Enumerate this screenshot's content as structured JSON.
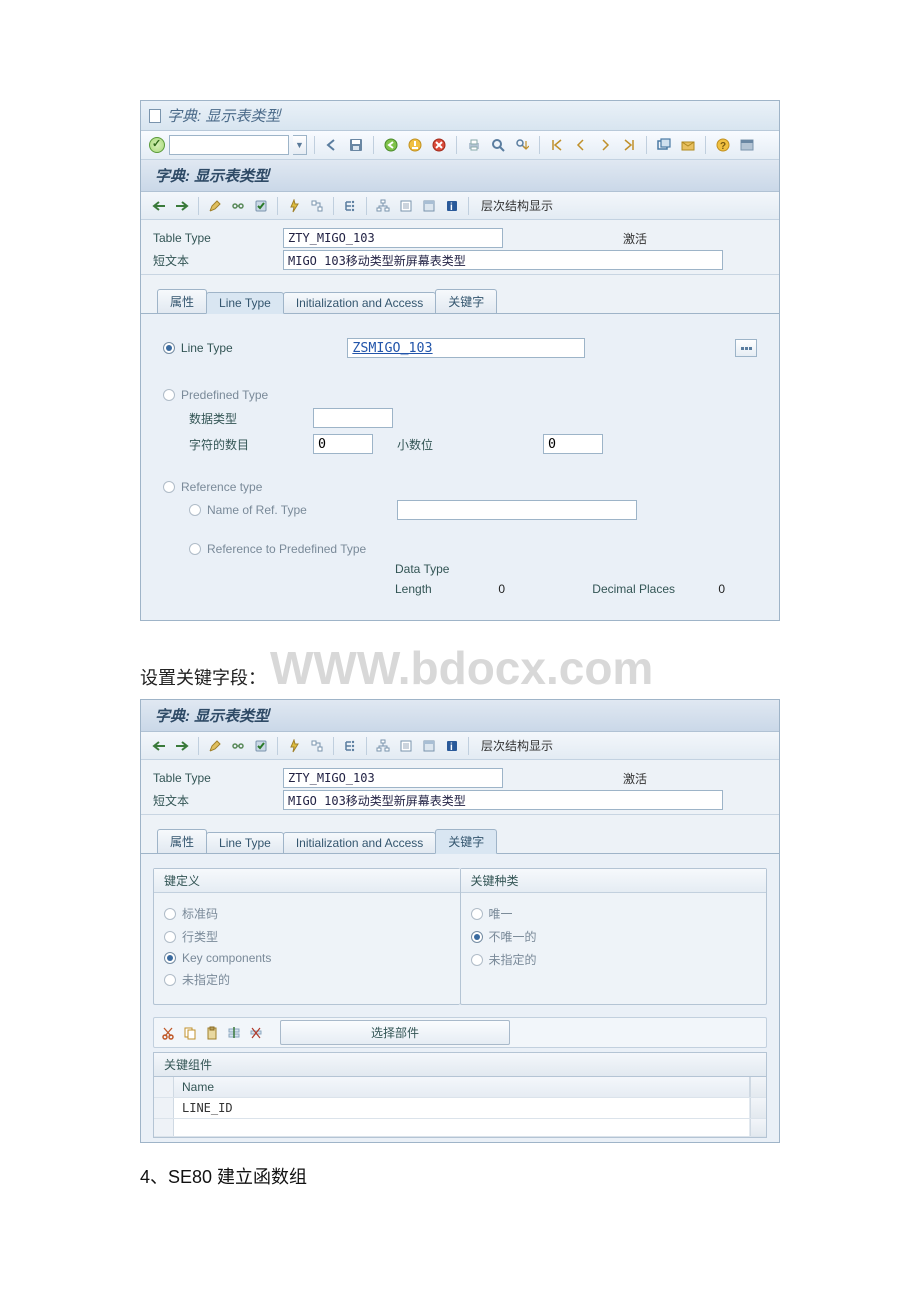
{
  "window_title": "字典: 显示表类型",
  "screen_title": "字典: 显示表类型",
  "app_toolbar_text": "层次结构显示",
  "header": {
    "table_type_label": "Table Type",
    "table_type_value": "ZTY_MIGO_103",
    "status": "激活",
    "short_text_label": "短文本",
    "short_text_value": "MIGO 103移动类型新屏幕表类型"
  },
  "tabs": {
    "attr": "属性",
    "line": "Line Type",
    "init": "Initialization and Access",
    "key": "关键字"
  },
  "linetype": {
    "line_type_label": "Line Type",
    "line_type_value": "ZSMIGO_103",
    "predef_label": "Predefined Type",
    "data_type_label": "数据类型",
    "charnum_label": "字符的数目",
    "charnum_value": "0",
    "decimals_label": "小数位",
    "decimals_value": "0",
    "ref_label": "Reference type",
    "refname_label": "Name of Ref. Type",
    "refpredef_label": "Reference to Predefined Type",
    "dtype_label": "Data Type",
    "length_label": "Length",
    "length_value": "0",
    "decpl_label": "Decimal Places",
    "decpl_value": "0"
  },
  "mid_caption_pre": "设置关键字段：",
  "watermark": "WWW.bdocx.com",
  "key": {
    "def_title": "键定义",
    "def_opts": {
      "std": "标准码",
      "row": "行类型",
      "comp": "Key components",
      "unspec": "未指定的"
    },
    "cat_title": "关键种类",
    "cat_opts": {
      "uniq": "唯一",
      "nuniq": "不唯一的",
      "unspec": "未指定的"
    },
    "choose_btn": "选择部件",
    "grid_title": "关键组件",
    "col_name": "Name",
    "row1": "LINE_ID"
  },
  "footnote": "4、SE80 建立函数组"
}
